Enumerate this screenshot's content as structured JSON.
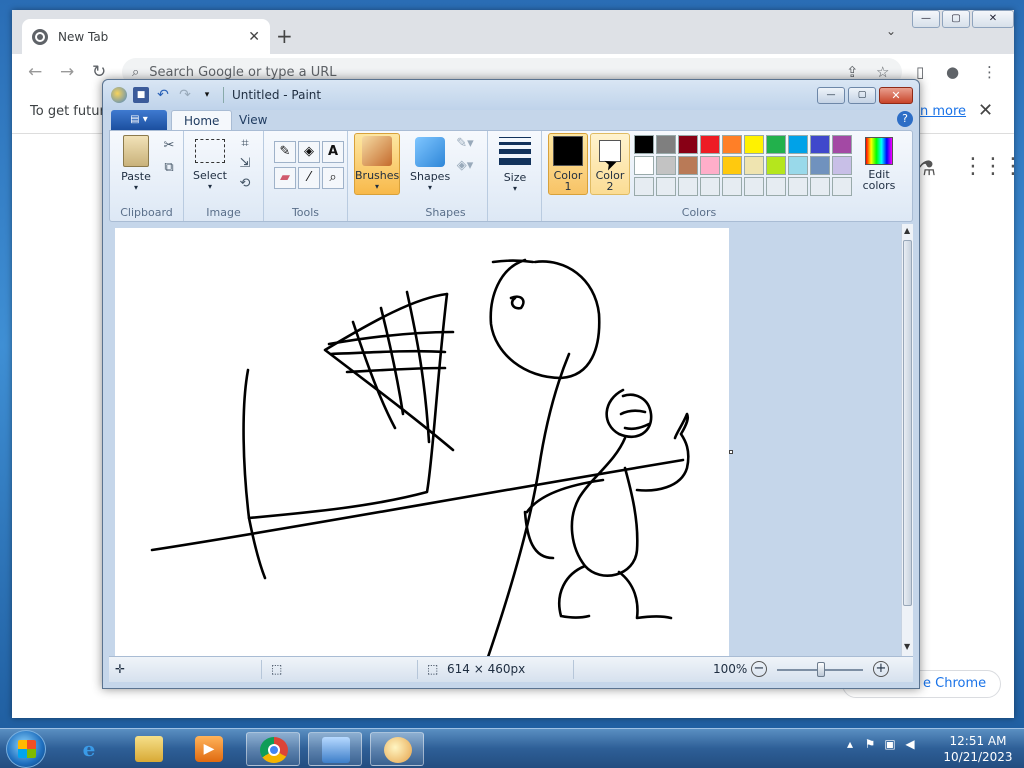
{
  "chrome": {
    "tab_title": "New Tab",
    "new_tab": "+",
    "tab_menu": "⌄",
    "window_controls": {
      "minimize": "—",
      "maximize": "▢",
      "close": "✕"
    },
    "nav": {
      "back": "←",
      "forward": "→",
      "reload": "↻"
    },
    "omnibox_placeholder": "Search Google or type a URL",
    "infobar_text": "To get future",
    "infobar_link": "n more",
    "infobar_close": "✕",
    "customize_label": "e Chrome",
    "icons": [
      "chrome-favicon-icon",
      "share-icon",
      "star-icon",
      "sidepanel-icon",
      "profile-icon",
      "kebab-menu-icon",
      "labs-icon",
      "apps-grid-icon"
    ]
  },
  "paint": {
    "title": "Untitled - Paint",
    "window_controls": {
      "minimize": "—",
      "maximize": "▢",
      "close": "✕"
    },
    "tabs": {
      "home": "Home",
      "view": "View"
    },
    "help": "?",
    "groups": {
      "clipboard": "Clipboard",
      "image": "Image",
      "tools": "Tools",
      "shapes": "Shapes",
      "colors": "Colors"
    },
    "buttons": {
      "paste": "Paste",
      "select": "Select",
      "brushes": "Brushes",
      "shapes": "Shapes",
      "size": "Size",
      "color1_l1": "Color",
      "color1_l2": "1",
      "color2_l1": "Color",
      "color2_l2": "2",
      "edit_colors_l1": "Edit",
      "edit_colors_l2": "colors"
    },
    "palette": {
      "row1": [
        "#000000",
        "#7f7f7f",
        "#880015",
        "#ed1c24",
        "#ff7f27",
        "#fff200",
        "#22b14c",
        "#00a2e8",
        "#3f48cc",
        "#a349a4"
      ],
      "row2": [
        "#ffffff",
        "#c3c3c3",
        "#b97a57",
        "#ffaec9",
        "#ffc90e",
        "#efe4b0",
        "#b5e61d",
        "#99d9ea",
        "#7092be",
        "#c8bfe7"
      ],
      "row3": [
        "#e6ecf2",
        "#e6ecf2",
        "#e6ecf2",
        "#e6ecf2",
        "#e6ecf2",
        "#e6ecf2",
        "#e6ecf2",
        "#e6ecf2",
        "#e6ecf2",
        "#e6ecf2"
      ]
    },
    "color1": "#000000",
    "color2": "#ffffff",
    "status": {
      "canvas_size": "614 × 460px",
      "zoom": "100%",
      "zoom_out": "−",
      "zoom_in": "+"
    }
  },
  "taskbar": {
    "time": "12:51 AM",
    "date": "10/21/2023",
    "apps": [
      "internet-explorer-icon",
      "file-explorer-icon",
      "media-player-icon",
      "chrome-icon",
      "control-panel-icon",
      "paint-icon"
    ]
  }
}
